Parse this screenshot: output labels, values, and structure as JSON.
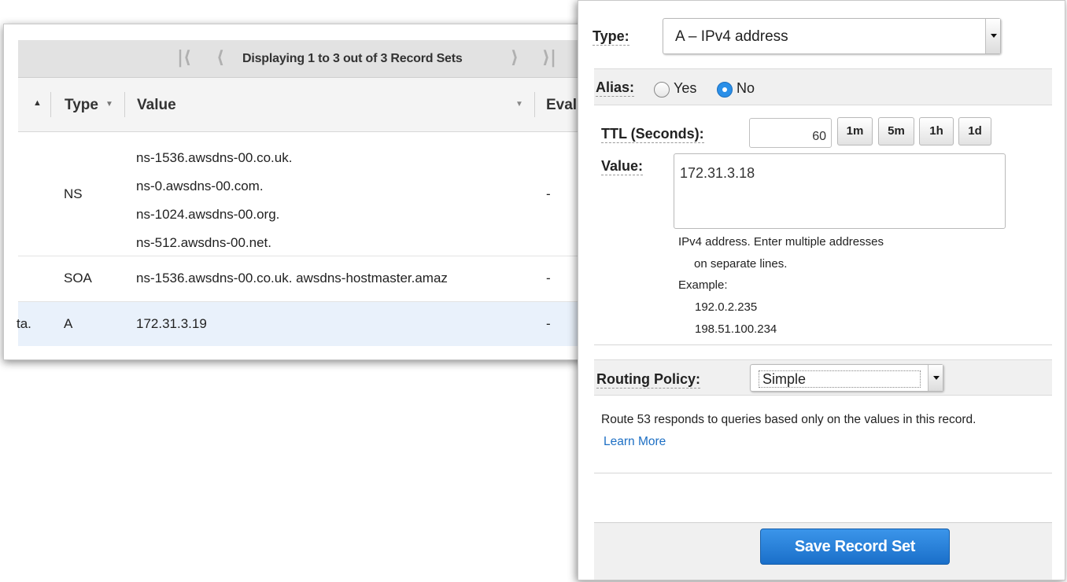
{
  "table": {
    "pager": {
      "first_icon": "pager-first-icon",
      "prev_icon": "pager-prev-icon",
      "next_icon": "pager-next-icon",
      "last_icon": "pager-last-icon",
      "text": "Displaying 1 to 3 out of 3 Record Sets"
    },
    "columns": {
      "type": "Type",
      "value": "Value",
      "evaluate": "Eval"
    },
    "rows": [
      {
        "name": "",
        "type": "NS",
        "values": [
          "ns-1536.awsdns-00.co.uk.",
          "ns-0.awsdns-00.com.",
          "ns-1024.awsdns-00.org.",
          "ns-512.awsdns-00.net."
        ],
        "evaluate": "-"
      },
      {
        "name": "",
        "type": "SOA",
        "values": [
          "ns-1536.awsdns-00.co.uk. awsdns-hostmaster.amaz"
        ],
        "evaluate": "-"
      },
      {
        "name": "ta.",
        "type": "A",
        "values": [
          "172.31.3.19"
        ],
        "evaluate": "-"
      }
    ]
  },
  "form": {
    "type_label": "Type:",
    "type_value": "A – IPv4 address",
    "alias_label": "Alias:",
    "alias_yes": "Yes",
    "alias_no": "No",
    "alias_selected": "No",
    "ttl_label": "TTL (Seconds):",
    "ttl_value": "60",
    "ttl_buttons": [
      "1m",
      "5m",
      "1h",
      "1d"
    ],
    "value_label": "Value:",
    "value_text": "172.31.3.18",
    "help": {
      "line1": "IPv4 address. Enter multiple addresses",
      "line2": "on separate lines.",
      "line3": "Example:",
      "line4": "192.0.2.235",
      "line5": "198.51.100.234"
    },
    "routing_label": "Routing Policy:",
    "routing_value": "Simple",
    "routing_description": "Route 53 responds to queries based only on the values in this record.",
    "learn_more": "Learn More",
    "save_label": "Save Record Set"
  },
  "colors": {
    "accent": "#1a6fc9",
    "link": "#1d6fc4",
    "selected_row": "#e9f1fb",
    "band": "#f0f0f0"
  }
}
